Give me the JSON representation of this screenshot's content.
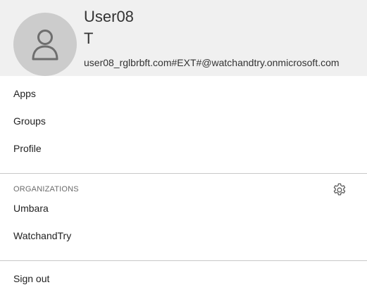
{
  "profile": {
    "first_name": "User08",
    "last_name": "T",
    "email": "user08_rglbrbft.com#EXT#@watchandtry.onmicrosoft.com",
    "avatar_icon": "person-icon"
  },
  "menu": {
    "items": [
      {
        "label": "Apps"
      },
      {
        "label": "Groups"
      },
      {
        "label": "Profile"
      }
    ]
  },
  "organizations": {
    "heading": "ORGANIZATIONS",
    "settings_icon": "gear-icon",
    "items": [
      {
        "label": "Umbara"
      },
      {
        "label": "WatchandTry"
      }
    ]
  },
  "footer": {
    "sign_out_label": "Sign out"
  },
  "colors": {
    "header_bg": "#f0f0f0",
    "avatar_bg": "#cccccc",
    "avatar_glyph": "#6e6e6e",
    "divider": "#c8c8c8"
  }
}
